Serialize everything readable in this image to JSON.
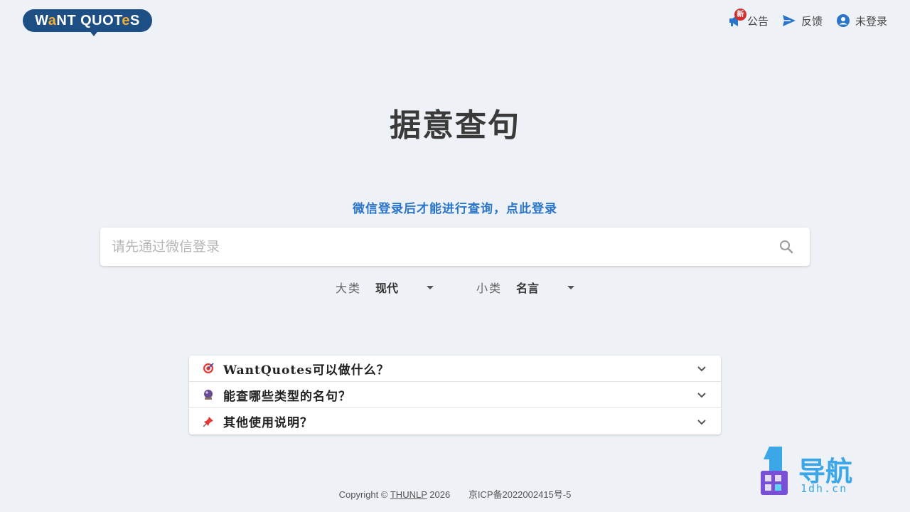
{
  "header": {
    "logo_text_a": "W",
    "logo_text_b": "NT QUOT",
    "logo_text_c": "S",
    "nav": {
      "announcement_label": "公告",
      "announcement_badge": "新",
      "feedback_label": "反馈",
      "user_label": "未登录"
    }
  },
  "main": {
    "title": "据意查句",
    "login_prompt": "微信登录后才能进行查询，点此登录",
    "search_placeholder": "请先通过微信登录"
  },
  "selectors": {
    "category_label": "大类",
    "category_value": "现代",
    "subcategory_label": "小类",
    "subcategory_value": "名言"
  },
  "faq": [
    {
      "icon": "target-icon",
      "text": "WantQuotes可以做什么？"
    },
    {
      "icon": "crystal-ball-icon",
      "text": "能查哪些类型的名句？"
    },
    {
      "icon": "pushpin-icon",
      "text": "其他使用说明？"
    }
  ],
  "footer": {
    "copyright_prefix": "Copyright ©",
    "org_link": "THUNLP",
    "year": "2026",
    "icp": "京ICP备2022002415号-5"
  },
  "watermark": {
    "text": "导航",
    "sub": "1dh.cn"
  },
  "colors": {
    "brand": "#1d4f84",
    "link": "#2a75c9",
    "background": "#eef1f5"
  }
}
